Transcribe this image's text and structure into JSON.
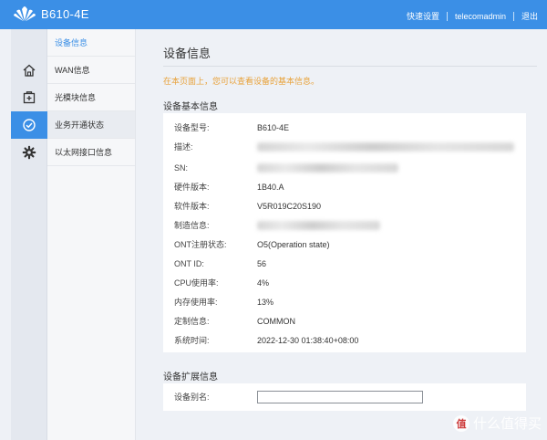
{
  "brand": {
    "title": "B610-4E"
  },
  "top_links": {
    "quick_setup": "快速设置",
    "user": "telecomadmin",
    "logout": "退出"
  },
  "rail": {
    "icons": [
      "home-icon",
      "add-box-icon",
      "status-check-icon",
      "gear-icon"
    ],
    "active_index": 2,
    "accent": "#3b8fe6"
  },
  "submenu": {
    "items": [
      {
        "label": "设备信息"
      },
      {
        "label": "WAN信息"
      },
      {
        "label": "光模块信息"
      },
      {
        "label": "业务开通状态"
      },
      {
        "label": "以太网接口信息"
      }
    ]
  },
  "main": {
    "title": "设备信息",
    "notice": "在本页面上，您可以查看设备的基本信息。",
    "basic_section": "设备基本信息",
    "rows": [
      {
        "label": "设备型号:",
        "value": "B610-4E"
      },
      {
        "label": "描述:",
        "value": ""
      },
      {
        "label": "SN:",
        "value": ""
      },
      {
        "label": "硬件版本:",
        "value": "1B40.A"
      },
      {
        "label": "软件版本:",
        "value": "V5R019C20S190"
      },
      {
        "label": "制造信息:",
        "value": ""
      },
      {
        "label": "ONT注册状态:",
        "value": "O5(Operation state)"
      },
      {
        "label": "ONT ID:",
        "value": "56"
      },
      {
        "label": "CPU使用率:",
        "value": "4%"
      },
      {
        "label": "内存使用率:",
        "value": "13%"
      },
      {
        "label": "定制信息:",
        "value": "COMMON"
      },
      {
        "label": "系统时间:",
        "value": "2022-12-30 01:38:40+08:00"
      }
    ],
    "ext_section": "设备扩展信息",
    "alias_label": "设备别名:",
    "alias_value": ""
  },
  "watermark": {
    "text": "什么值得买",
    "badge": "值"
  },
  "colors": {
    "header": "#3b8fe6",
    "notice": "#e8a23b",
    "panel": "#ffffff",
    "background": "#eef1f6"
  }
}
